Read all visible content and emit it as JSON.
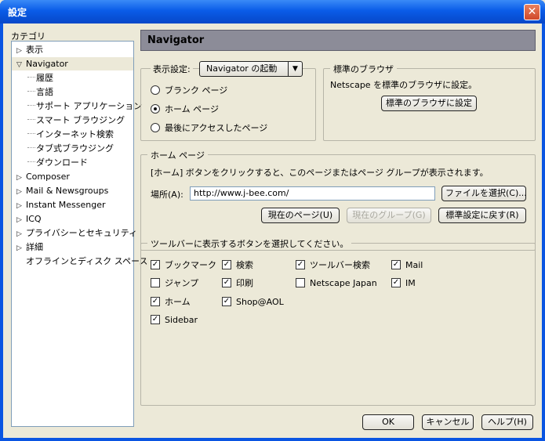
{
  "window": {
    "title": "設定",
    "close_glyph": "✕"
  },
  "sidebar": {
    "label": "カテゴリ",
    "items": [
      {
        "label": "表示",
        "twisty": "▷"
      },
      {
        "label": "Navigator",
        "twisty": "▽"
      },
      {
        "label": "履歴"
      },
      {
        "label": "言語"
      },
      {
        "label": "サポート アプリケーション"
      },
      {
        "label": "スマート ブラウジング"
      },
      {
        "label": "インターネット検索"
      },
      {
        "label": "タブ式ブラウジング"
      },
      {
        "label": "ダウンロード"
      },
      {
        "label": "Composer",
        "twisty": "▷"
      },
      {
        "label": "Mail & Newsgroups",
        "twisty": "▷"
      },
      {
        "label": "Instant Messenger",
        "twisty": "▷"
      },
      {
        "label": "ICQ",
        "twisty": "▷"
      },
      {
        "label": "プライバシーとセキュリティ",
        "twisty": "▷"
      },
      {
        "label": "詳細",
        "twisty": "▷"
      },
      {
        "label": "オフラインとディスク スペース"
      }
    ]
  },
  "panel": {
    "title": "Navigator",
    "display": {
      "label": "表示設定:",
      "dropdown_value": "Navigator の起動",
      "options": [
        "ブランク ページ",
        "ホーム ページ",
        "最後にアクセスしたページ"
      ],
      "selected": 1
    },
    "default_browser": {
      "title": "標準のブラウザ",
      "description": "Netscape を標準のブラウザに設定。",
      "button": "標準のブラウザに設定"
    },
    "home_page": {
      "title": "ホーム ページ",
      "description": "[ホーム] ボタンをクリックすると、このページまたはページ グループが表示されます。",
      "location_label": "場所(A):",
      "location_value": "http://www.j-bee.com/",
      "choose_file": "ファイルを選択(C)...",
      "current_page": "現在のページ(U)",
      "current_group": "現在のグループ(G)",
      "restore_default": "標準設定に戻す(R)"
    },
    "toolbar": {
      "title": "ツールバーに表示するボタンを選択してください。",
      "checkboxes": [
        {
          "label": "ブックマーク",
          "checked": true
        },
        {
          "label": "ジャンプ",
          "checked": false
        },
        {
          "label": "ホーム",
          "checked": true
        },
        {
          "label": "Sidebar",
          "checked": true
        },
        {
          "label": "検索",
          "checked": true
        },
        {
          "label": "印刷",
          "checked": true
        },
        {
          "label": "Shop@AOL",
          "checked": true
        },
        {
          "label": "ツールバー検索",
          "checked": true
        },
        {
          "label": "Netscape Japan",
          "checked": false
        },
        {
          "label": "Mail",
          "checked": true
        },
        {
          "label": "IM",
          "checked": true
        }
      ]
    }
  },
  "footer": {
    "ok": "OK",
    "cancel": "キャンセル",
    "help": "ヘルプ(H)"
  }
}
